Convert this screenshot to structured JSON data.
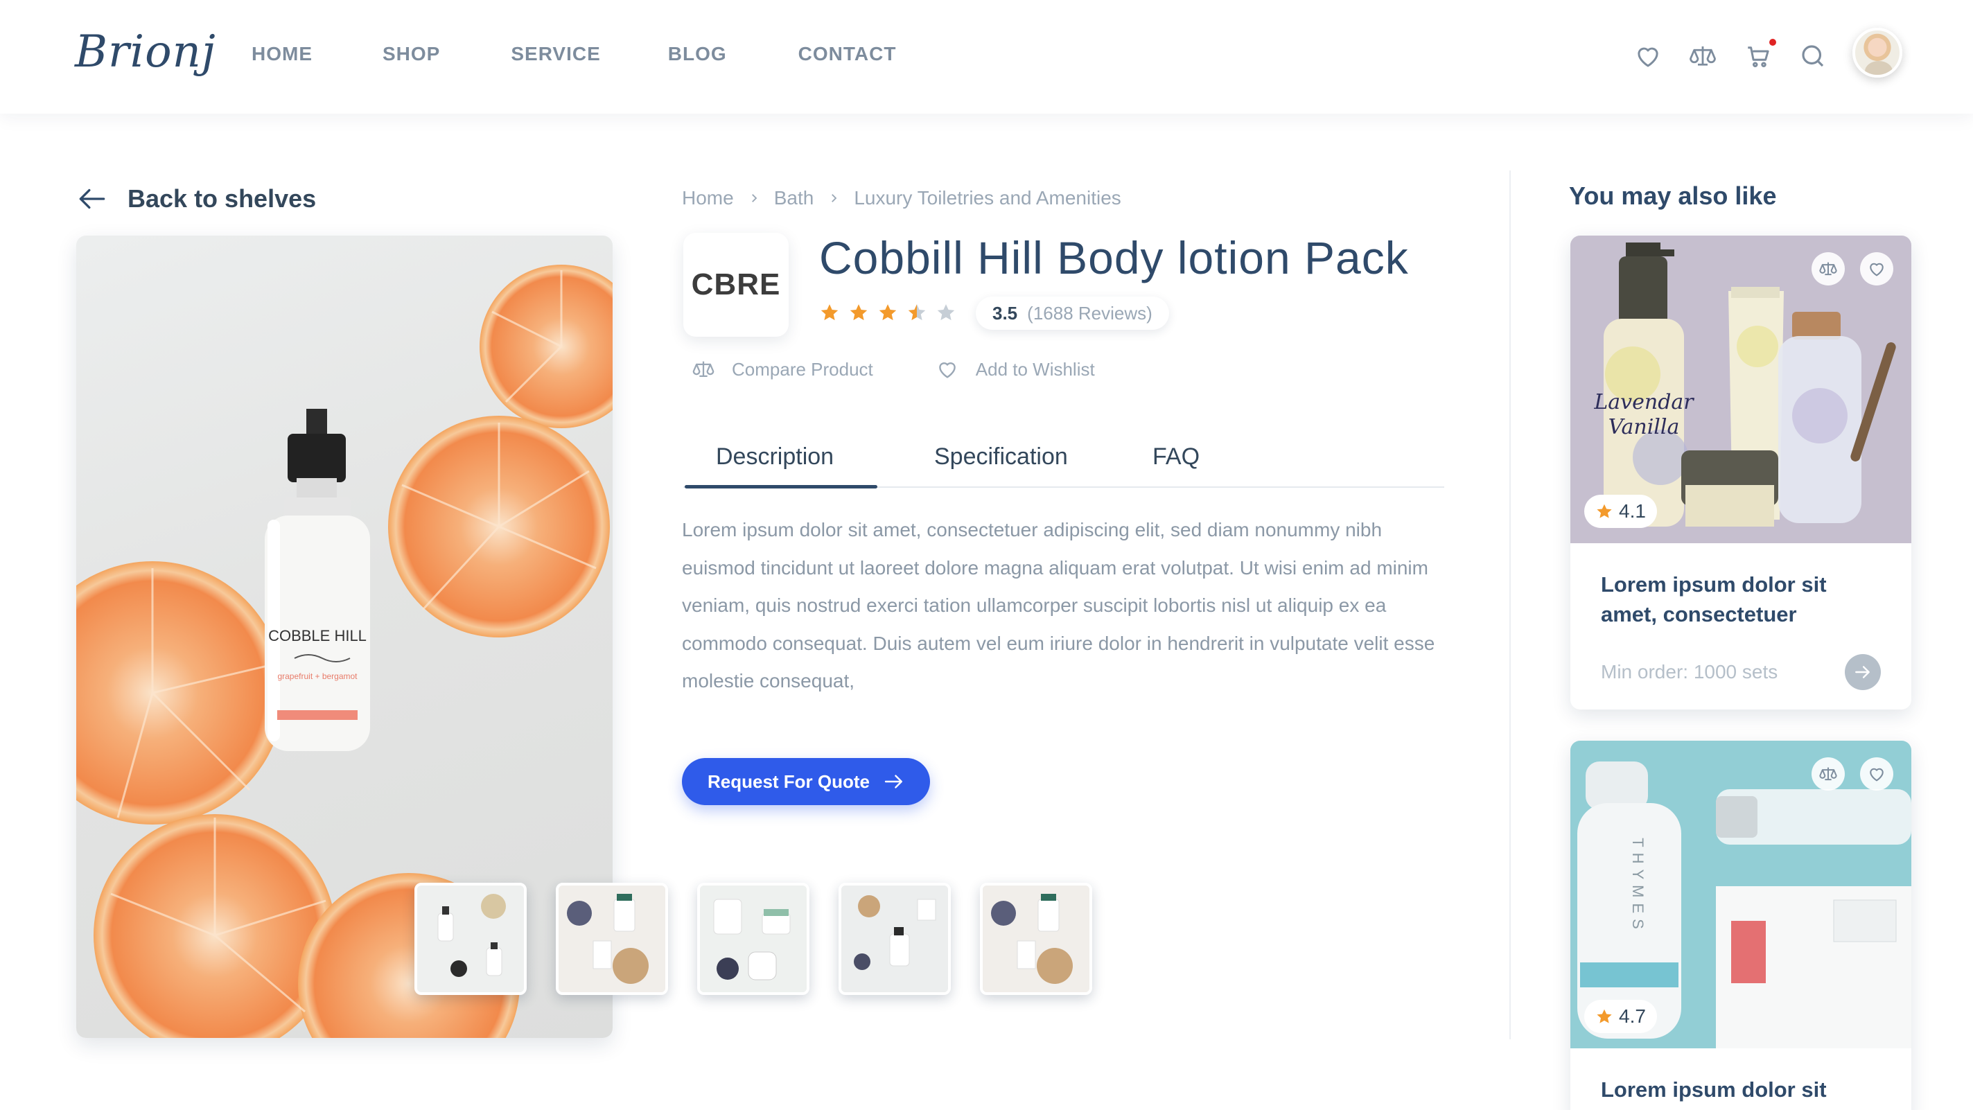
{
  "header": {
    "logo": "Brionj",
    "nav": [
      {
        "label": "HOME"
      },
      {
        "label": "SHOP"
      },
      {
        "label": "SERVICE"
      },
      {
        "label": "BLOG"
      },
      {
        "label": "CONTACT"
      }
    ],
    "icons": [
      "heart-icon",
      "compare-scale-icon",
      "cart-icon",
      "search-icon"
    ],
    "cart_has_notification": true
  },
  "back_link": {
    "label": "Back to shelves"
  },
  "breadcrumb": [
    "Home",
    "Bath",
    "Luxury Toiletries and Amenities"
  ],
  "product": {
    "brand_logo": "CBRE",
    "title": "Cobbill Hill Body lotion Pack",
    "rating": 3.5,
    "rating_label": "3.5",
    "reviews_label": "(1688 Reviews)",
    "compare_label": "Compare Product",
    "wishlist_label": "Add to Wishlist",
    "tabs": [
      {
        "label": "Description",
        "active": true
      },
      {
        "label": "Specification",
        "active": false
      },
      {
        "label": "FAQ",
        "active": false
      }
    ],
    "description": "Lorem ipsum dolor sit amet, consectetuer adipiscing elit, sed diam nonummy nibh euismod tincidunt ut laoreet dolore magna aliquam erat volutpat. Ut wisi enim ad minim veniam, quis nostrud exerci tation ullamcorper suscipit lobortis nisl ut aliquip ex ea commodo consequat. Duis autem vel eum iriure dolor in hendrerit in vulputate velit esse molestie consequat,",
    "quote_button": "Request For Quote",
    "hero_bottle_label": "COBBLE HILL",
    "thumbnails_count": 5
  },
  "also_like": {
    "title": "You may also like",
    "cards": [
      {
        "rating": "4.1",
        "name": "Lorem ipsum dolor sit amet, consectetuer",
        "min_order": "Min order: 1000 sets",
        "image_text_1": "Lavendar",
        "image_text_2": "Vanilla"
      },
      {
        "rating": "4.7",
        "name": "Lorem ipsum dolor sit",
        "min_order": "",
        "image_text_1": "THYMES",
        "image_text_2": ""
      }
    ]
  },
  "colors": {
    "accent": "#2f5bea",
    "heading": "#2f4a6a",
    "muted": "#9aa7b5",
    "star": "#f39a2c",
    "star_empty": "#c6ced6"
  }
}
